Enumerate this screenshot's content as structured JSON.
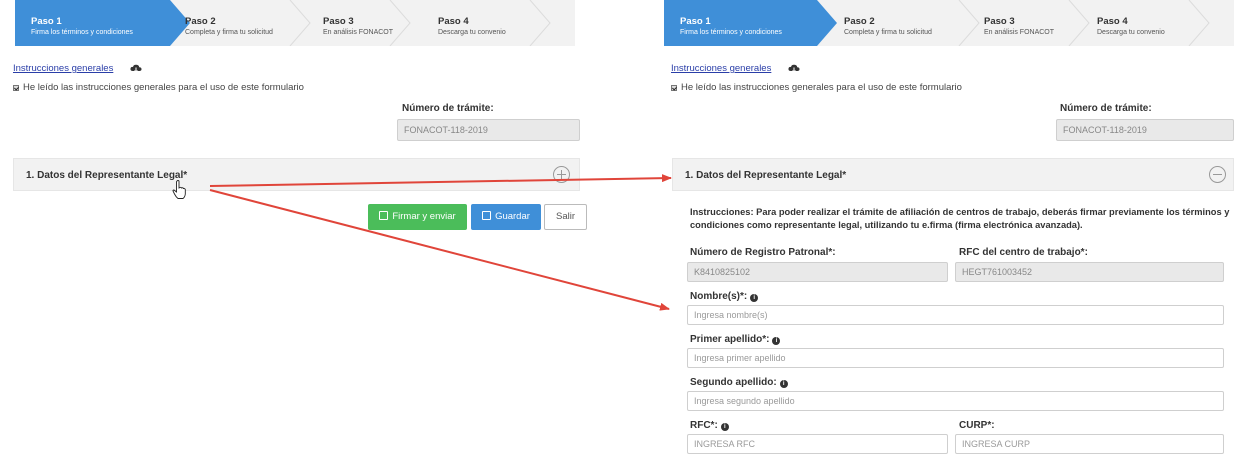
{
  "steps": [
    {
      "title": "Paso 1",
      "subtitle": "Firma los términos y condiciones"
    },
    {
      "title": "Paso 2",
      "subtitle": "Completa y firma tu solicitud"
    },
    {
      "title": "Paso 3",
      "subtitle": "En análisis FONACOT"
    },
    {
      "title": "Paso 4",
      "subtitle": "Descarga tu convenio"
    }
  ],
  "instructions_link": "Instrucciones generales",
  "read_checkbox_label": "He leído las instrucciones generales para el uso de este formulario",
  "tramite": {
    "label": "Número de trámite:",
    "value": "FONACOT-118-2019"
  },
  "section1_title": "1. Datos del Representante Legal*",
  "buttons": {
    "sign": "Firmar y enviar",
    "save": "Guardar",
    "exit": "Salir"
  },
  "form": {
    "instructions": "Instrucciones: Para poder realizar el trámite de afiliación de centros de trabajo, deberás firmar previamente los términos y condiciones como representante legal, utilizando tu e.firma (firma electrónica avanzada).",
    "registro_label": "Número de Registro Patronal*:",
    "registro_value": "K8410825102",
    "rfc_centro_label": "RFC del centro de trabajo*:",
    "rfc_centro_value": "HEGT761003452",
    "nombre_label": "Nombre(s)*:",
    "nombre_placeholder": "Ingresa nombre(s)",
    "primer_label": "Primer apellido*:",
    "primer_placeholder": "Ingresa primer apellido",
    "segundo_label": "Segundo apellido:",
    "segundo_placeholder": "Ingresa segundo apellido",
    "rfc_label": "RFC*:",
    "rfc_placeholder": "INGRESA RFC",
    "curp_label": "CURP*:",
    "curp_placeholder": "INGRESA CURP"
  },
  "colors": {
    "active_step": "#3f8fd8",
    "arrow": "#e0453a",
    "green_button": "#4bbd5a",
    "blue_button": "#3f8fd8"
  },
  "icons": [
    "cloud-download-icon",
    "info-icon",
    "plus-circle-icon",
    "minus-circle-icon",
    "edit-icon",
    "save-icon",
    "hand-cursor-icon",
    "arrow-icon"
  ]
}
